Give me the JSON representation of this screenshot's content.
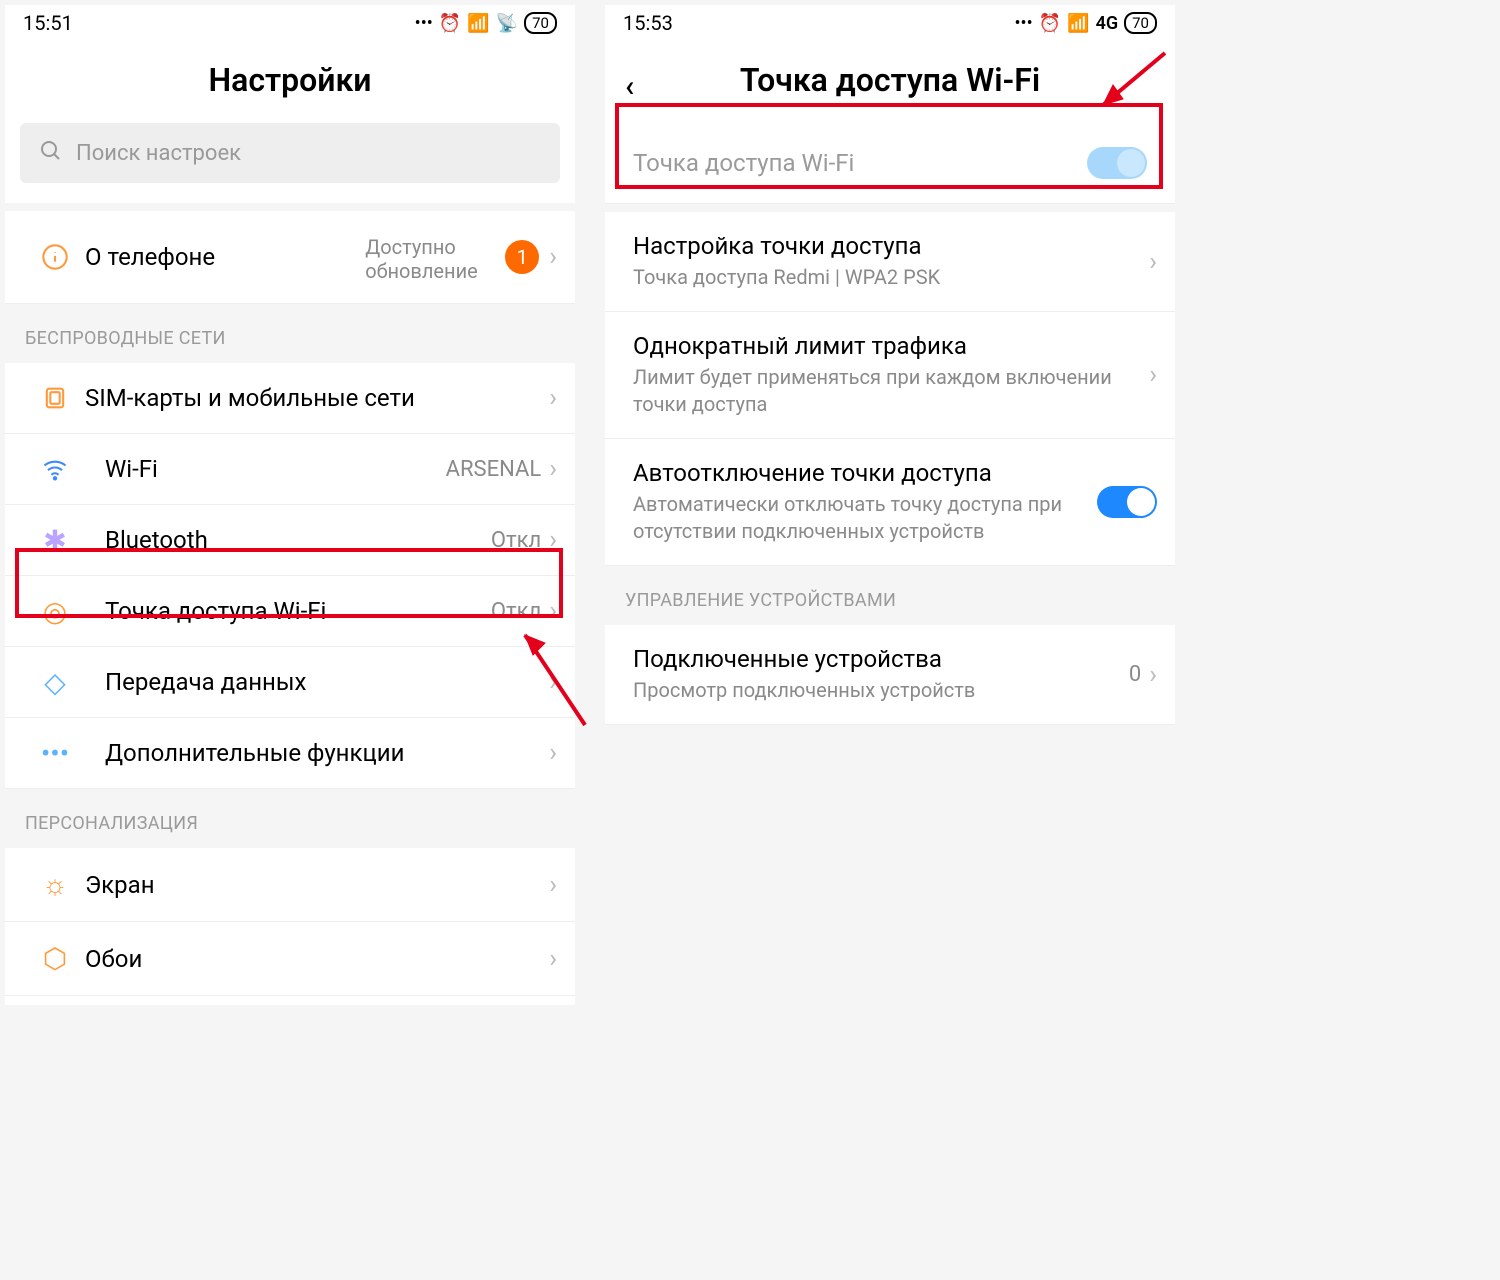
{
  "left": {
    "status": {
      "time": "15:51",
      "battery": "70"
    },
    "header": "Настройки",
    "search_placeholder": "Поиск настроек",
    "about": {
      "title": "О телефоне",
      "sub": "Доступно обновление",
      "badge": "1"
    },
    "section_wireless": "БЕСПРОВОДНЫЕ СЕТИ",
    "rows": {
      "sim": {
        "title": "SIM-карты и мобильные сети"
      },
      "wifi": {
        "title": "Wi-Fi",
        "value": "ARSENAL"
      },
      "bt": {
        "title": "Bluetooth",
        "value": "Откл"
      },
      "hot": {
        "title": "Точка доступа Wi-Fi",
        "value": "Откл"
      },
      "data": {
        "title": "Передача данных"
      },
      "more": {
        "title": "Дополнительные функции"
      }
    },
    "section_personal": "ПЕРСОНАЛИЗАЦИЯ",
    "rows2": {
      "screen": {
        "title": "Экран"
      },
      "wall": {
        "title": "Обои"
      }
    }
  },
  "right": {
    "status": {
      "time": "15:53",
      "net": "4G",
      "battery": "70"
    },
    "header": "Точка доступа Wi-Fi",
    "toggle_row": {
      "title": "Точка доступа Wi-Fi"
    },
    "rows": {
      "setup": {
        "title": "Настройка точки доступа",
        "sub": "Точка доступа Redmi | WPA2 PSK"
      },
      "limit": {
        "title": "Однократный лимит трафика",
        "sub": "Лимит будет применяться при каждом включении точки доступа"
      },
      "auto": {
        "title": "Автоотключение точки доступа",
        "sub": "Автоматически отключать точку доступа при отсутствии подключенных устройств"
      }
    },
    "section_devices": "УПРАВЛЕНИЕ УСТРОЙСТВАМИ",
    "devices": {
      "title": "Подключенные устройства",
      "sub": "Просмотр подключенных устройств",
      "value": "0"
    }
  }
}
